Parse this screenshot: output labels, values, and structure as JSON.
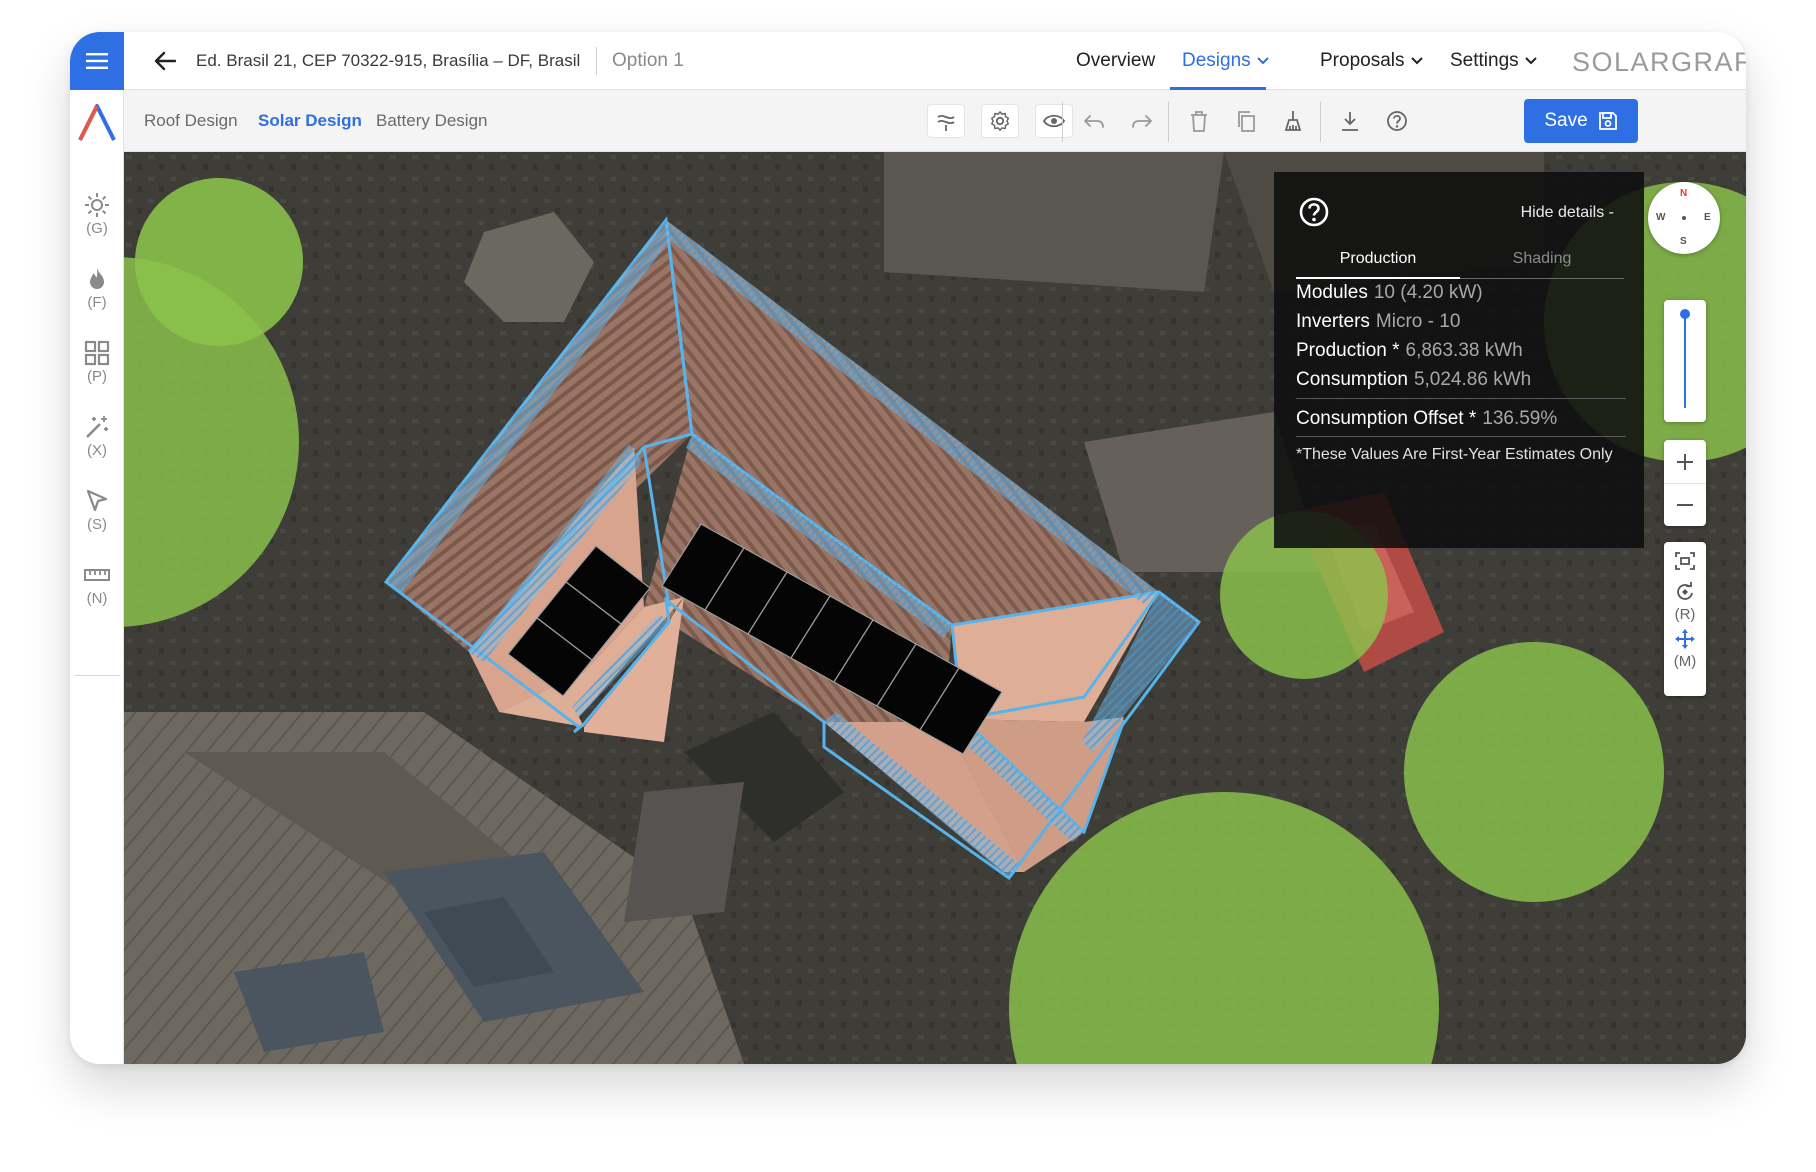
{
  "header": {
    "address": "Ed. Brasil 21, CEP 70322-915, Brasília – DF, Brasil",
    "option": "Option 1",
    "nav": [
      {
        "label": "Overview"
      },
      {
        "label": "Designs"
      },
      {
        "label": "Proposals"
      },
      {
        "label": "Settings"
      }
    ],
    "brand": "SOLARGRAF"
  },
  "sidebar": {
    "tools": [
      {
        "key": "(G)",
        "icon": "sun-icon"
      },
      {
        "key": "(F)",
        "icon": "flame-icon"
      },
      {
        "key": "(P)",
        "icon": "grid-icon"
      },
      {
        "key": "(X)",
        "icon": "magic-wand-icon"
      },
      {
        "key": "(S)",
        "icon": "select-arrow-icon"
      },
      {
        "key": "(N)",
        "icon": "ruler-icon"
      }
    ]
  },
  "toolbar": {
    "tabs": [
      "Roof Design",
      "Solar Design",
      "Battery Design"
    ],
    "active_tab": "Solar Design",
    "icons": [
      "layers-icon",
      "settings-icon",
      "eye-icon",
      "undo-icon",
      "redo-icon",
      "delete-icon",
      "copy-icon",
      "vacuum-icon",
      "download-icon",
      "help-icon"
    ],
    "save_label": "Save"
  },
  "panel": {
    "hide_label": "Hide details -",
    "tabs": [
      "Production",
      "Shading"
    ],
    "rows": {
      "modules": {
        "label": "Modules",
        "value": "10 (4.20 kW)"
      },
      "inverters": {
        "label": "Inverters",
        "value": "Micro - 10"
      },
      "production": {
        "label": "Production *",
        "value": "6,863.38 kWh"
      },
      "consumption": {
        "label": "Consumption",
        "value": "5,024.86 kWh"
      },
      "offset": {
        "label": "Consumption Offset *",
        "value": "136.59%"
      }
    },
    "note": "*These Values Are First-Year Estimates Only"
  },
  "compass": {
    "n": "N",
    "s": "S",
    "e": "E",
    "w": "W"
  },
  "view_controls": {
    "rotate_key": "(R)",
    "move_key": "(M)"
  },
  "colors": {
    "accent": "#2f6fe4",
    "tree_overlay": "#8bc34a",
    "roof_outline": "#4aa8e0",
    "panel_bg": "#0e0e0e"
  }
}
